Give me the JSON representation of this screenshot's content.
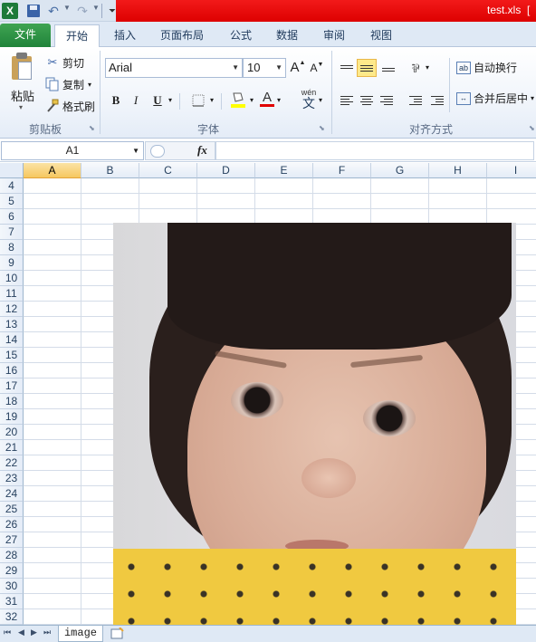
{
  "titlebar": {
    "title": "test.xls",
    "title_extra": "[",
    "logo": "X"
  },
  "qat": {
    "save_icon": "save-icon",
    "undo_icon": "undo-icon",
    "redo_icon": "redo-icon",
    "customize_icon": "customize-icon"
  },
  "tabs": [
    {
      "label": "文件"
    },
    {
      "label": "开始"
    },
    {
      "label": "插入"
    },
    {
      "label": "页面布局"
    },
    {
      "label": "公式"
    },
    {
      "label": "数据"
    },
    {
      "label": "审阅"
    },
    {
      "label": "视图"
    }
  ],
  "clipboard": {
    "paste_label": "粘贴",
    "cut_label": "剪切",
    "copy_label": "复制",
    "format_painter_label": "格式刷",
    "group_label": "剪贴板"
  },
  "font": {
    "font_name": "Arial",
    "font_size": "10",
    "grow": "A",
    "shrink": "A",
    "bold": "B",
    "italic": "I",
    "underline": "U",
    "font_color_glyph": "A",
    "wen": "wén",
    "wen_char": "文",
    "group_label": "字体"
  },
  "alignment": {
    "wrap_label": "自动换行",
    "merge_label": "合并后居中",
    "group_label": "对齐方式"
  },
  "formula_bar": {
    "name_box": "A1",
    "fx": "fx"
  },
  "grid": {
    "columns": [
      "A",
      "B",
      "C",
      "D",
      "E",
      "F",
      "G",
      "H",
      "I"
    ],
    "rows": [
      "4",
      "5",
      "6",
      "7",
      "8",
      "9",
      "10",
      "11",
      "12",
      "13",
      "14",
      "15",
      "16",
      "17",
      "18",
      "19",
      "20",
      "21",
      "22",
      "23",
      "24",
      "25",
      "26",
      "27",
      "28",
      "29",
      "30",
      "31",
      "32"
    ],
    "selected_column": "A"
  },
  "sheets": {
    "tabs": [
      "image"
    ]
  },
  "colors": {
    "title_red": "#e00000",
    "file_tab_green": "#2a8f43",
    "selected_header": "#f6c760"
  }
}
